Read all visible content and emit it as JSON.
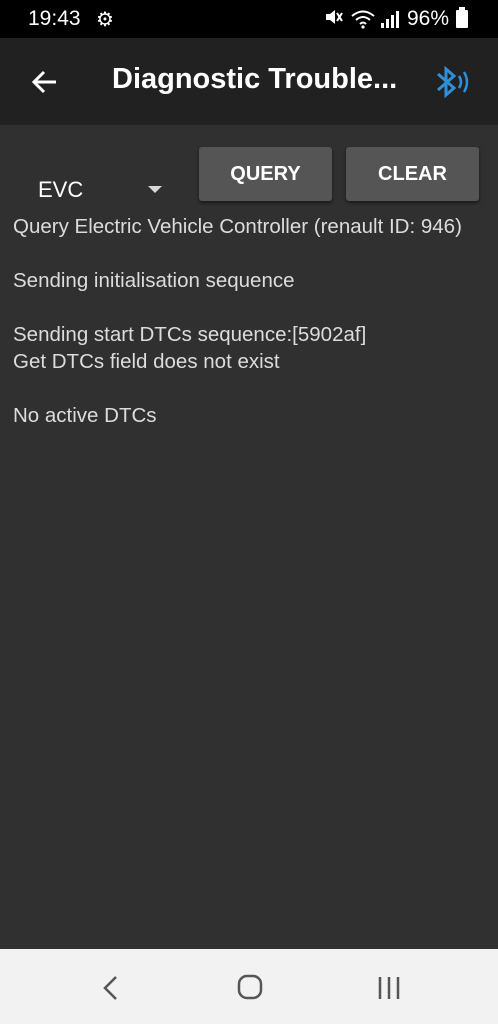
{
  "status_bar": {
    "time": "19:43",
    "battery": "96%"
  },
  "app_bar": {
    "title": "Diagnostic Trouble..."
  },
  "controls": {
    "module_selected": "EVC",
    "query_label": "QUERY",
    "clear_label": "CLEAR"
  },
  "log": [
    "Query Electric Vehicle Controller (renault ID: 946)",
    "Sending initialisation sequence",
    "Sending start DTCs sequence:[5902af]\nGet DTCs field does not exist",
    "No active DTCs"
  ],
  "colors": {
    "background": "#303030",
    "app_bar": "#212121",
    "button": "#555555",
    "bluetooth_accent": "#2f8fd8"
  },
  "icons": [
    "settings-gear-icon",
    "mute-icon",
    "wifi-icon",
    "signal-icon",
    "battery-icon",
    "back-arrow-icon",
    "bluetooth-icon",
    "nav-back-icon",
    "nav-home-icon",
    "nav-recent-apps-icon"
  ]
}
